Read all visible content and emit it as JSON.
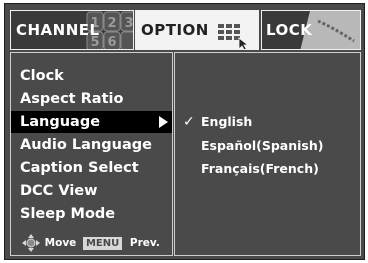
{
  "tabs": [
    {
      "label": "CHANNEL",
      "active": false
    },
    {
      "label": "OPTION",
      "active": true
    },
    {
      "label": "LOCK",
      "active": false
    }
  ],
  "menu": {
    "items": [
      {
        "label": "Clock"
      },
      {
        "label": "Aspect Ratio"
      },
      {
        "label": "Language",
        "selected": true
      },
      {
        "label": "Audio Language"
      },
      {
        "label": "Caption Select"
      },
      {
        "label": "DCC View"
      },
      {
        "label": "Sleep Mode"
      }
    ]
  },
  "submenu": {
    "options": [
      {
        "label": "English",
        "checked": true
      },
      {
        "label": "Español(Spanish)",
        "checked": false
      },
      {
        "label": "Français(French)",
        "checked": false
      }
    ]
  },
  "hint": {
    "move_label": "Move",
    "menu_key": "MENU",
    "prev_label": "Prev."
  },
  "icons": [
    "check-icon",
    "right-arrow-icon",
    "navigation-pad-icon",
    "option-grid-icon",
    "cursor-icon"
  ],
  "colors": {
    "background": "#4a4a4a",
    "selected_row": "#000000",
    "active_tab": "#f3f3f3",
    "text": "#ffffff"
  }
}
